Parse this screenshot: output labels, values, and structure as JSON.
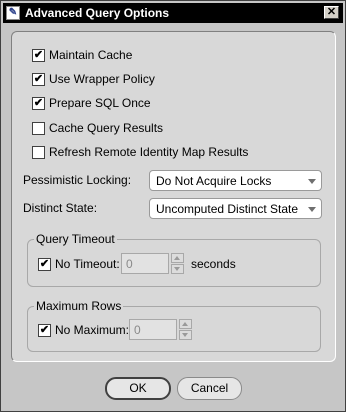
{
  "window": {
    "title": "Advanced Query Options",
    "close_glyph": "✕",
    "app_icon": "app-icon"
  },
  "options": {
    "maintain_cache": {
      "label": "Maintain Cache",
      "checked": true
    },
    "use_wrapper_policy": {
      "label": "Use Wrapper Policy",
      "checked": true
    },
    "prepare_sql_once": {
      "label": "Prepare SQL Once",
      "checked": true
    },
    "cache_query_results": {
      "label": "Cache Query Results",
      "checked": false
    },
    "refresh_remote": {
      "label": "Refresh Remote Identity Map Results",
      "checked": false
    }
  },
  "pessimistic_locking": {
    "label": "Pessimistic Locking:",
    "value": "Do Not Acquire Locks"
  },
  "distinct_state": {
    "label": "Distinct State:",
    "value": "Uncomputed Distinct State"
  },
  "query_timeout": {
    "title": "Query Timeout",
    "no_timeout_label": "No Timeout:",
    "no_timeout_checked": true,
    "value": "0",
    "unit": "seconds"
  },
  "maximum_rows": {
    "title": "Maximum Rows",
    "no_maximum_label": "No Maximum:",
    "no_maximum_checked": true,
    "value": "0"
  },
  "buttons": {
    "ok": "OK",
    "cancel": "Cancel"
  },
  "check_glyph": "✔"
}
